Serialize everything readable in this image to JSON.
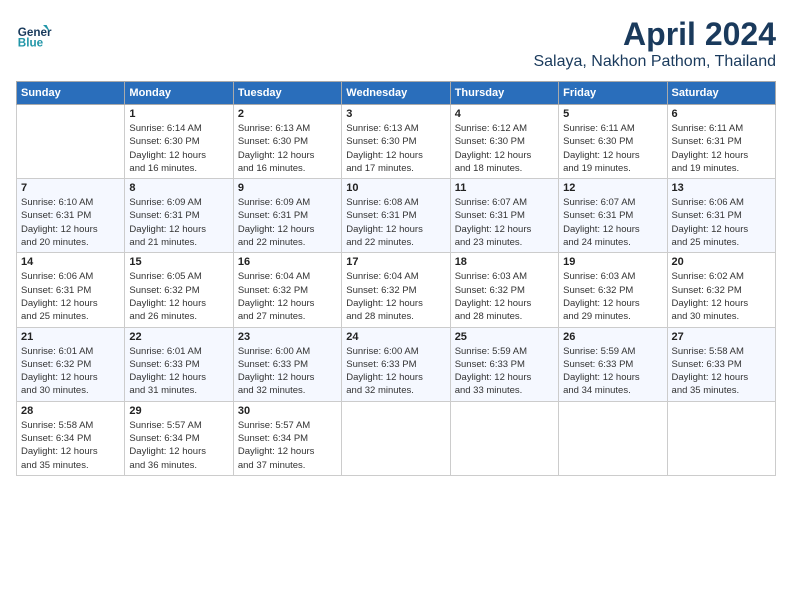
{
  "header": {
    "logo_line1": "General",
    "logo_line2": "Blue",
    "month": "April 2024",
    "location": "Salaya, Nakhon Pathom, Thailand"
  },
  "weekdays": [
    "Sunday",
    "Monday",
    "Tuesday",
    "Wednesday",
    "Thursday",
    "Friday",
    "Saturday"
  ],
  "weeks": [
    [
      {
        "day": "",
        "info": ""
      },
      {
        "day": "1",
        "info": "Sunrise: 6:14 AM\nSunset: 6:30 PM\nDaylight: 12 hours\nand 16 minutes."
      },
      {
        "day": "2",
        "info": "Sunrise: 6:13 AM\nSunset: 6:30 PM\nDaylight: 12 hours\nand 16 minutes."
      },
      {
        "day": "3",
        "info": "Sunrise: 6:13 AM\nSunset: 6:30 PM\nDaylight: 12 hours\nand 17 minutes."
      },
      {
        "day": "4",
        "info": "Sunrise: 6:12 AM\nSunset: 6:30 PM\nDaylight: 12 hours\nand 18 minutes."
      },
      {
        "day": "5",
        "info": "Sunrise: 6:11 AM\nSunset: 6:30 PM\nDaylight: 12 hours\nand 19 minutes."
      },
      {
        "day": "6",
        "info": "Sunrise: 6:11 AM\nSunset: 6:31 PM\nDaylight: 12 hours\nand 19 minutes."
      }
    ],
    [
      {
        "day": "7",
        "info": "Sunrise: 6:10 AM\nSunset: 6:31 PM\nDaylight: 12 hours\nand 20 minutes."
      },
      {
        "day": "8",
        "info": "Sunrise: 6:09 AM\nSunset: 6:31 PM\nDaylight: 12 hours\nand 21 minutes."
      },
      {
        "day": "9",
        "info": "Sunrise: 6:09 AM\nSunset: 6:31 PM\nDaylight: 12 hours\nand 22 minutes."
      },
      {
        "day": "10",
        "info": "Sunrise: 6:08 AM\nSunset: 6:31 PM\nDaylight: 12 hours\nand 22 minutes."
      },
      {
        "day": "11",
        "info": "Sunrise: 6:07 AM\nSunset: 6:31 PM\nDaylight: 12 hours\nand 23 minutes."
      },
      {
        "day": "12",
        "info": "Sunrise: 6:07 AM\nSunset: 6:31 PM\nDaylight: 12 hours\nand 24 minutes."
      },
      {
        "day": "13",
        "info": "Sunrise: 6:06 AM\nSunset: 6:31 PM\nDaylight: 12 hours\nand 25 minutes."
      }
    ],
    [
      {
        "day": "14",
        "info": "Sunrise: 6:06 AM\nSunset: 6:31 PM\nDaylight: 12 hours\nand 25 minutes."
      },
      {
        "day": "15",
        "info": "Sunrise: 6:05 AM\nSunset: 6:32 PM\nDaylight: 12 hours\nand 26 minutes."
      },
      {
        "day": "16",
        "info": "Sunrise: 6:04 AM\nSunset: 6:32 PM\nDaylight: 12 hours\nand 27 minutes."
      },
      {
        "day": "17",
        "info": "Sunrise: 6:04 AM\nSunset: 6:32 PM\nDaylight: 12 hours\nand 28 minutes."
      },
      {
        "day": "18",
        "info": "Sunrise: 6:03 AM\nSunset: 6:32 PM\nDaylight: 12 hours\nand 28 minutes."
      },
      {
        "day": "19",
        "info": "Sunrise: 6:03 AM\nSunset: 6:32 PM\nDaylight: 12 hours\nand 29 minutes."
      },
      {
        "day": "20",
        "info": "Sunrise: 6:02 AM\nSunset: 6:32 PM\nDaylight: 12 hours\nand 30 minutes."
      }
    ],
    [
      {
        "day": "21",
        "info": "Sunrise: 6:01 AM\nSunset: 6:32 PM\nDaylight: 12 hours\nand 30 minutes."
      },
      {
        "day": "22",
        "info": "Sunrise: 6:01 AM\nSunset: 6:33 PM\nDaylight: 12 hours\nand 31 minutes."
      },
      {
        "day": "23",
        "info": "Sunrise: 6:00 AM\nSunset: 6:33 PM\nDaylight: 12 hours\nand 32 minutes."
      },
      {
        "day": "24",
        "info": "Sunrise: 6:00 AM\nSunset: 6:33 PM\nDaylight: 12 hours\nand 32 minutes."
      },
      {
        "day": "25",
        "info": "Sunrise: 5:59 AM\nSunset: 6:33 PM\nDaylight: 12 hours\nand 33 minutes."
      },
      {
        "day": "26",
        "info": "Sunrise: 5:59 AM\nSunset: 6:33 PM\nDaylight: 12 hours\nand 34 minutes."
      },
      {
        "day": "27",
        "info": "Sunrise: 5:58 AM\nSunset: 6:33 PM\nDaylight: 12 hours\nand 35 minutes."
      }
    ],
    [
      {
        "day": "28",
        "info": "Sunrise: 5:58 AM\nSunset: 6:34 PM\nDaylight: 12 hours\nand 35 minutes."
      },
      {
        "day": "29",
        "info": "Sunrise: 5:57 AM\nSunset: 6:34 PM\nDaylight: 12 hours\nand 36 minutes."
      },
      {
        "day": "30",
        "info": "Sunrise: 5:57 AM\nSunset: 6:34 PM\nDaylight: 12 hours\nand 37 minutes."
      },
      {
        "day": "",
        "info": ""
      },
      {
        "day": "",
        "info": ""
      },
      {
        "day": "",
        "info": ""
      },
      {
        "day": "",
        "info": ""
      }
    ]
  ]
}
